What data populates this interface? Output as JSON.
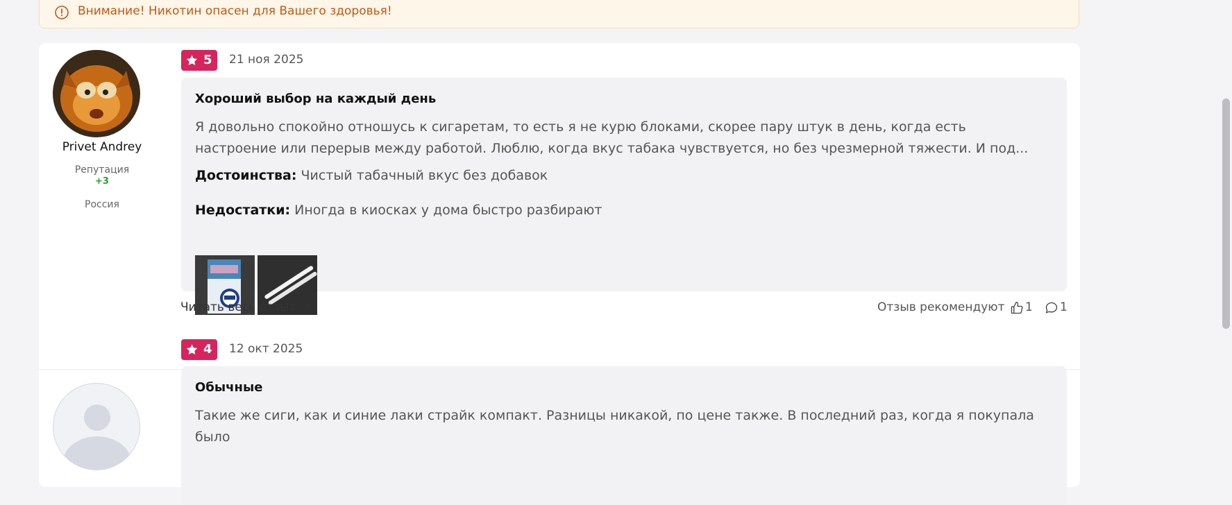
{
  "warning": {
    "icon": "alert-circle-icon",
    "text": "Внимание! Никотин опасен для Вашего здоровья!"
  },
  "colors": {
    "accent": "#d6245d",
    "warning_text": "#c8560f",
    "reputation": "#23a12f"
  },
  "reviews": [
    {
      "user": {
        "name": "Privet Andrey",
        "reputation_label": "Репутация",
        "reputation_value": "+3",
        "country": "Россия"
      },
      "rating": "5",
      "date": "21 ноя 2025",
      "title": "Хороший выбор на каждый день",
      "text": "Я довольно спокойно отношусь к сигаретам, то есть я не курю блоками, скорее пару штук в день, когда есть настроение или перерыв между работой. Люблю, когда вкус табака чувствуется, но без чрезмерной тяжести. И под...",
      "pros_label": "Достоинства:",
      "pros": "Чистый табачный вкус без добавок",
      "cons_label": "Недостатки:",
      "cons": "Иногда в киосках у дома быстро разбирают",
      "read_more": "Читать весь отзыв",
      "recommend_label": "Отзыв рекомендуют",
      "likes": "1",
      "comments": "1"
    },
    {
      "rating": "4",
      "date": "12 окт 2025",
      "title": "Обычные",
      "text": "Такие же сиги, как и синие лаки страйк компакт. Разницы никакой, по цене также. В последний раз, когда я покупала было"
    }
  ]
}
